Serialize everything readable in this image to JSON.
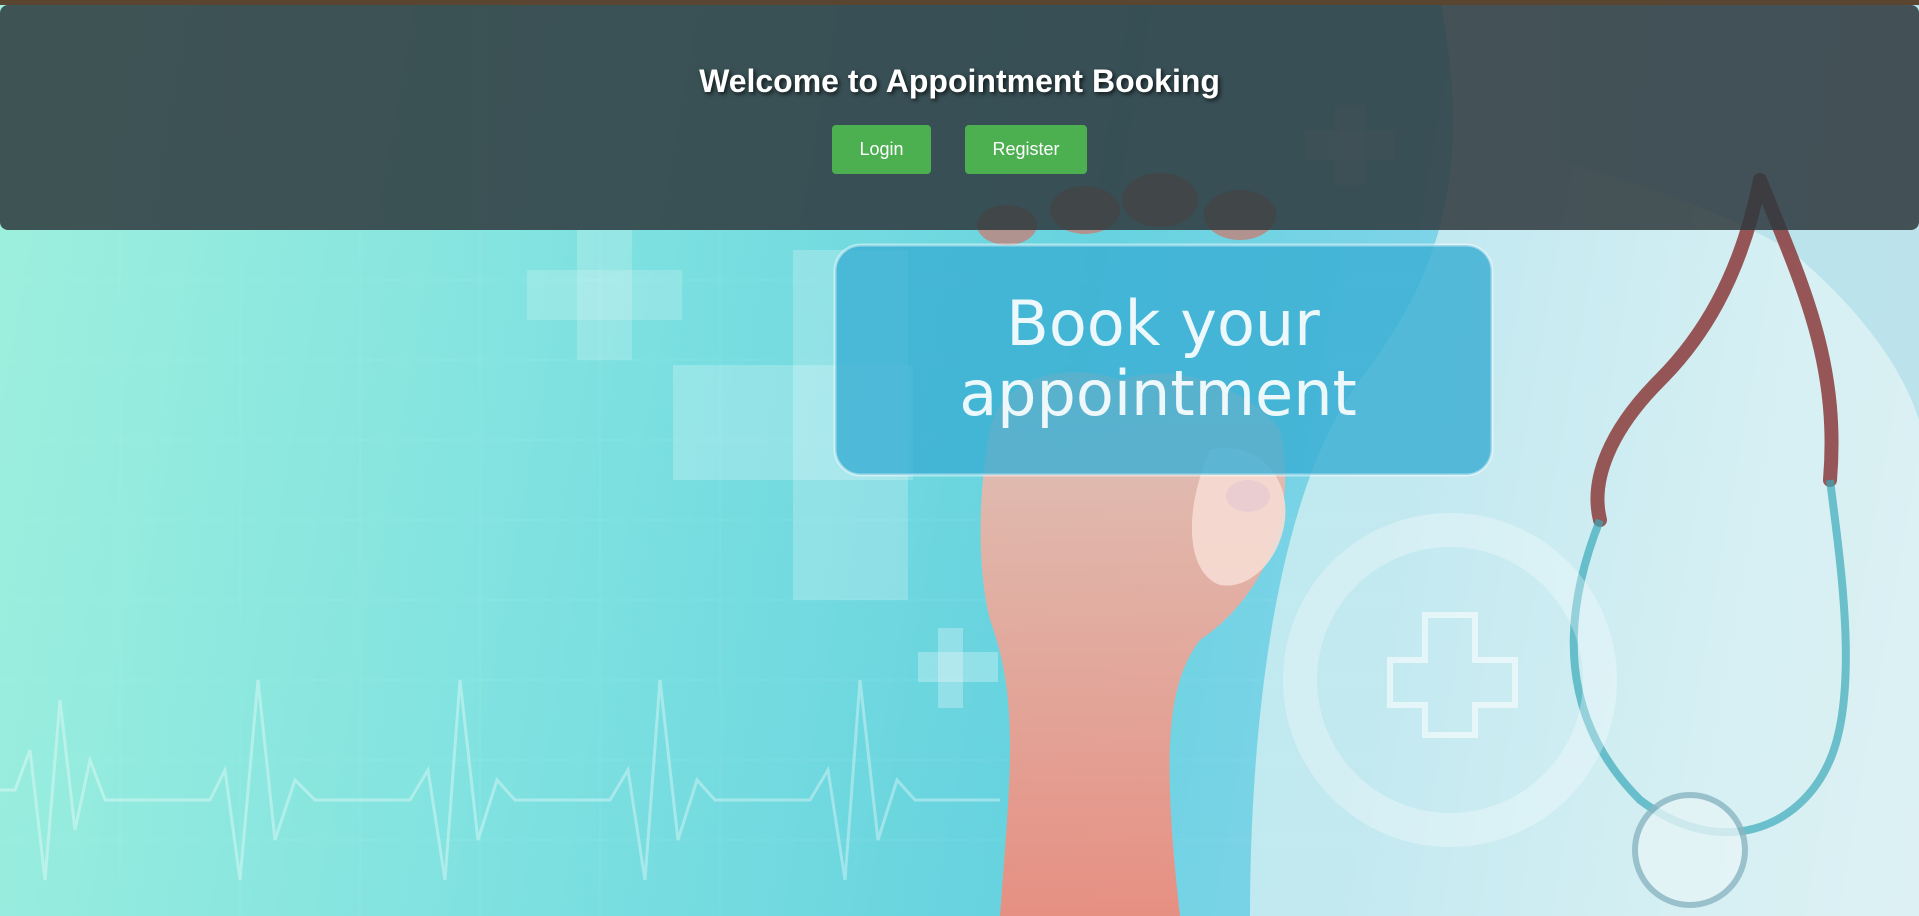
{
  "header": {
    "title": "Welcome to Appointment Booking",
    "login_label": "Login",
    "register_label": "Register"
  },
  "hero": {
    "card_line1": "Book your",
    "card_line2": "appointment"
  },
  "colors": {
    "button_bg": "#4caf50",
    "header_bg": "rgba(47,57,62,0.86)",
    "hero_teal": "#67d3df",
    "card_blue": "#3aaed3"
  },
  "icons": [
    "medical-cross-icon",
    "heartbeat-line",
    "stethoscope"
  ]
}
